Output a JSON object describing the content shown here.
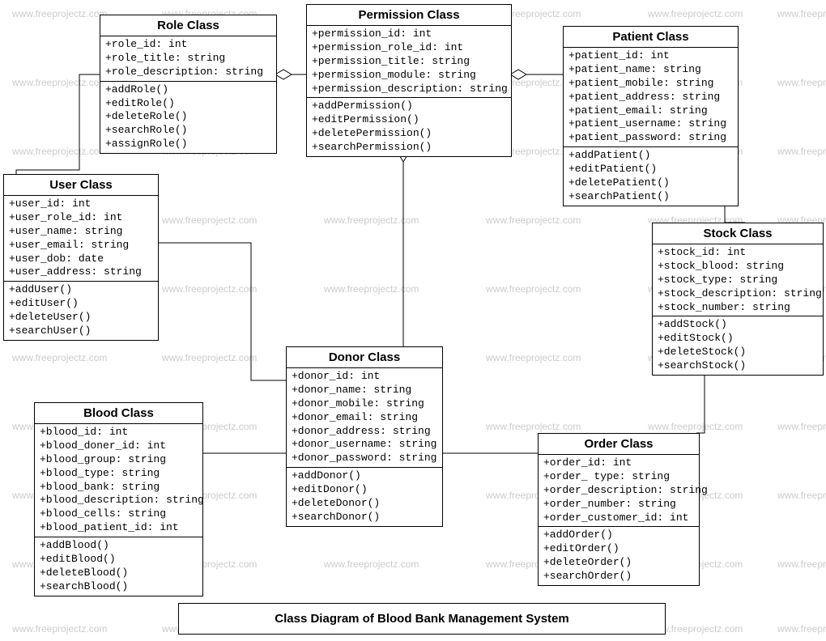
{
  "title": "Class Diagram of Blood Bank Management System",
  "watermark_text": "www.freeprojectz.com",
  "classes": {
    "role": {
      "name": "Role Class",
      "attrs": [
        "+role_id: int",
        "+role_title: string",
        "+role_description: string"
      ],
      "ops": [
        "+addRole()",
        "+editRole()",
        "+deleteRole()",
        "+searchRole()",
        "+assignRole()"
      ]
    },
    "permission": {
      "name": "Permission Class",
      "attrs": [
        "+permission_id: int",
        "+permission_role_id: int",
        "+permission_title: string",
        "+permission_module: string",
        "+permission_description: string"
      ],
      "ops": [
        "+addPermission()",
        "+editPermission()",
        "+deletePermission()",
        "+searchPermission()"
      ]
    },
    "patient": {
      "name": "Patient Class",
      "attrs": [
        "+patient_id: int",
        "+patient_name: string",
        "+patient_mobile: string",
        "+patient_address: string",
        "+patient_email: string",
        "+patient_username: string",
        "+patient_password: string"
      ],
      "ops": [
        "+addPatient()",
        "+editPatient()",
        "+deletePatient()",
        "+searchPatient()"
      ]
    },
    "user": {
      "name": "User Class",
      "attrs": [
        "+user_id: int",
        "+user_role_id: int",
        "+user_name: string",
        "+user_email: string",
        "+user_dob: date",
        "+user_address: string"
      ],
      "ops": [
        "+addUser()",
        "+editUser()",
        "+deleteUser()",
        "+searchUser()"
      ]
    },
    "stock": {
      "name": "Stock Class",
      "attrs": [
        "+stock_id: int",
        "+stock_blood: string",
        "+stock_type: string",
        "+stock_description: string",
        "+stock_number: string"
      ],
      "ops": [
        "+addStock()",
        "+editStock()",
        "+deleteStock()",
        "+searchStock()"
      ]
    },
    "donor": {
      "name": "Donor Class",
      "attrs": [
        "+donor_id: int",
        "+donor_name: string",
        "+donor_mobile: string",
        "+donor_email: string",
        "+donor_address: string",
        "+donor_username: string",
        "+donor_password: string"
      ],
      "ops": [
        "+addDonor()",
        "+editDonor()",
        "+deleteDonor()",
        "+searchDonor()"
      ]
    },
    "blood": {
      "name": "Blood Class",
      "attrs": [
        "+blood_id: int",
        "+blood_doner_id: int",
        "+blood_group: string",
        "+blood_type: string",
        "+blood_bank: string",
        "+blood_description: string",
        "+blood_cells: string",
        "+blood_patient_id: int"
      ],
      "ops": [
        "+addBlood()",
        "+editBlood()",
        "+deleteBlood()",
        "+searchBlood()"
      ]
    },
    "order": {
      "name": "Order Class",
      "attrs": [
        "+order_id: int",
        "+order_ type: string",
        "+order_description: string",
        "+order_number: string",
        "+order_customer_id: int"
      ],
      "ops": [
        "+addOrder()",
        "+editOrder()",
        "+deleteOrder()",
        "+searchOrder()"
      ]
    }
  }
}
